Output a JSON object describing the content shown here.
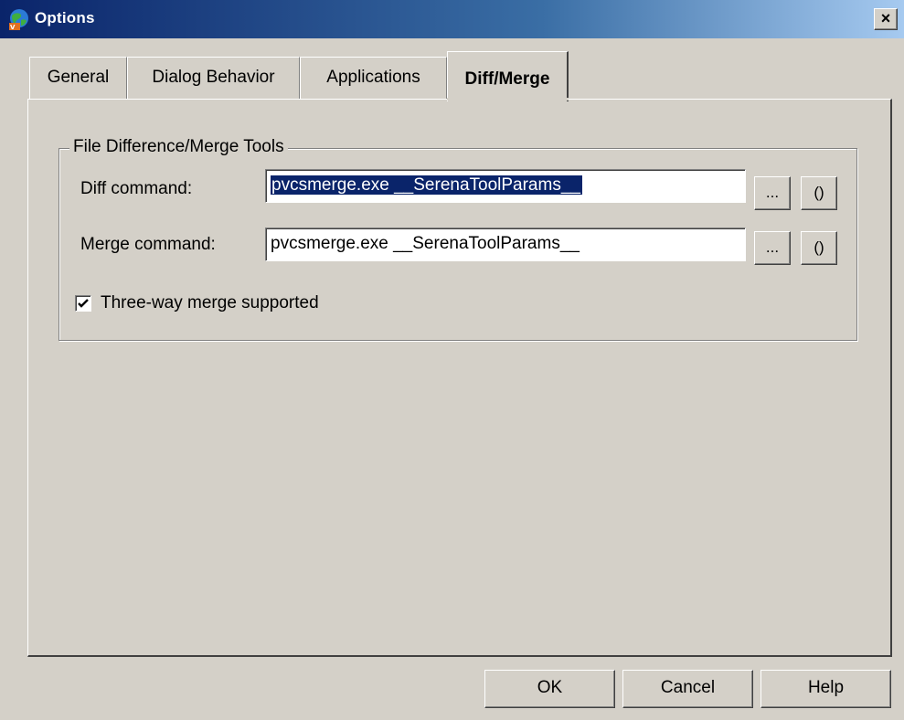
{
  "window": {
    "title": "Options",
    "close_label": "×"
  },
  "tabs": [
    {
      "label": "General",
      "active": false
    },
    {
      "label": "Dialog Behavior",
      "active": false
    },
    {
      "label": "Applications",
      "active": false
    },
    {
      "label": "Diff/Merge",
      "active": true
    }
  ],
  "group": {
    "legend": "File Difference/Merge Tools",
    "diff_label": "Diff command:",
    "diff_value": "pvcsmerge.exe __SerenaToolParams__",
    "merge_label": "Merge command:",
    "merge_value": "pvcsmerge.exe __SerenaToolParams__",
    "browse_label": "...",
    "params_label": "()",
    "threeway_label": "Three-way merge supported",
    "threeway_checked": true
  },
  "buttons": {
    "ok": "OK",
    "cancel": "Cancel",
    "help": "Help"
  },
  "colors": {
    "titlebar_start": "#0a246a",
    "titlebar_end": "#a6caf0",
    "dialog_bg": "#d4d0c8",
    "selection": "#0a246a"
  },
  "icons": {
    "title": "app-globe-icon",
    "close": "close-icon",
    "check": "checkmark-icon"
  }
}
